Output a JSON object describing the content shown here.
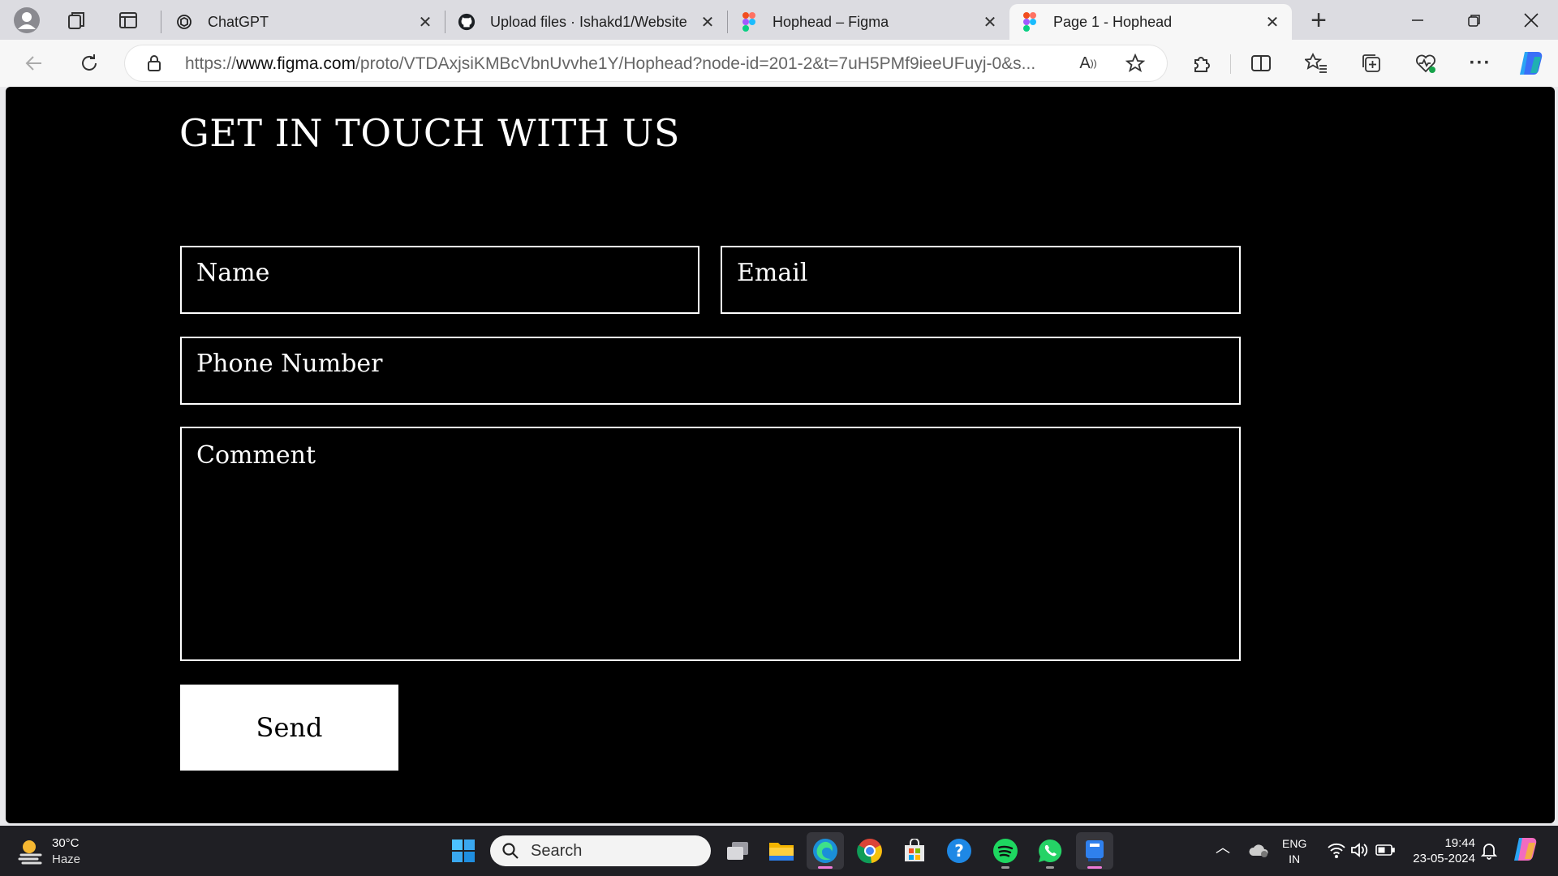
{
  "browser": {
    "tabs": [
      {
        "label": "ChatGPT"
      },
      {
        "label": "Upload files · Ishakd1/Website"
      },
      {
        "label": "Hophead – Figma"
      },
      {
        "label": "Page 1 - Hophead"
      }
    ],
    "url_prefix": "https://",
    "url_domain": "www.figma.com",
    "url_path": "/proto/VTDAxjsiKMBcVbnUvvhe1Y/Hophead?node-id=201-2&t=7uH5PMf9ieeUFuyj-0&s..."
  },
  "page": {
    "heading": "GET IN TOUCH WITH US",
    "fields": {
      "name": "Name",
      "email": "Email",
      "phone": "Phone Number",
      "comment": "Comment"
    },
    "send_label": "Send"
  },
  "taskbar": {
    "weather_temp": "30°C",
    "weather_desc": "Haze",
    "search_label": "Search",
    "lang_line1": "ENG",
    "lang_line2": "IN",
    "time": "19:44",
    "date": "23-05-2024"
  },
  "colors": {
    "canvas_bg": "#000000",
    "form_text": "#ffffff",
    "button_bg": "#ffffff",
    "active_app_indicator": "#f07ad7"
  },
  "icons": [
    "profile-icon",
    "workspaces-icon",
    "tab-actions-icon",
    "chatgpt-icon",
    "github-icon",
    "figma-icon",
    "close-icon",
    "new-tab-icon",
    "minimize-icon",
    "restore-icon",
    "back-icon",
    "refresh-icon",
    "lock-icon",
    "read-aloud-icon",
    "favorite-star-icon",
    "extensions-icon",
    "split-screen-icon",
    "favorites-icon",
    "collections-icon",
    "browser-essentials-icon",
    "more-icon",
    "copilot-icon",
    "weather-icon",
    "windows-start-icon",
    "search-icon",
    "task-view-icon",
    "file-explorer-icon",
    "edge-icon",
    "chrome-icon",
    "store-icon",
    "help-icon",
    "spotify-icon",
    "whatsapp-icon",
    "figma-app-icon",
    "chevron-up-icon",
    "onedrive-icon",
    "wifi-icon",
    "volume-icon",
    "battery-icon",
    "notifications-icon"
  ]
}
